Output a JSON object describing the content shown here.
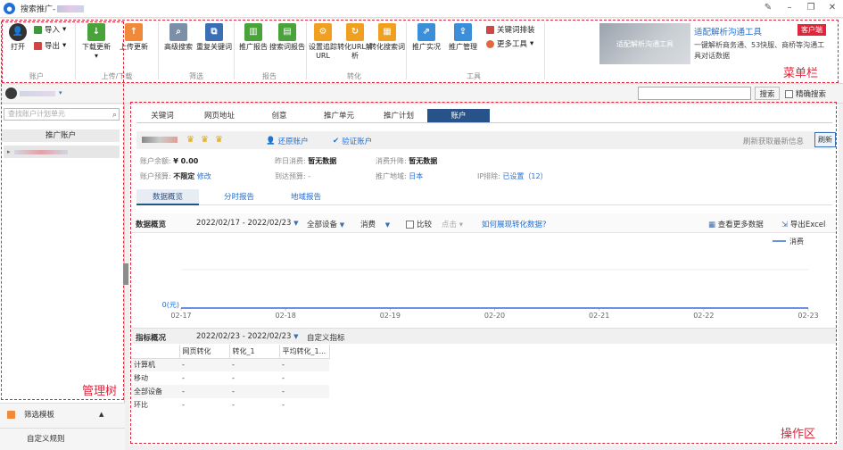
{
  "window": {
    "title": "搜索推广-"
  },
  "ribbon": {
    "groups": {
      "account": "账户",
      "updown": "上传/下载",
      "filter": "筛选",
      "report": "报告",
      "convert": "转化",
      "tools": "工具"
    },
    "open": "打开",
    "import": "导入",
    "export": "导出",
    "download": "下载更新",
    "upload": "上传更新",
    "advanced_search": "高级搜索",
    "repeat_kw": "重复关键词",
    "promo_report": "推广报告",
    "search_term_report": "搜索词报告",
    "set_tracking": "设置追踪URL",
    "url_parse": "转化URL解析",
    "search_convert": "转化搜索词",
    "promo_live": "推广实况",
    "promo_manage": "推广管理",
    "kw_tool": "关键词排装",
    "more_tools": "更多工具",
    "promo": {
      "image_text": "适配解析沟通工具",
      "title": "适配解析沟通工具",
      "badge": "客户端",
      "desc": "一键解析商务通、53快服、商桥等沟通工具对话数据"
    },
    "menu_label": "菜单栏"
  },
  "userbar": {
    "search_btn": "搜索",
    "exact": "精确搜索"
  },
  "tree": {
    "search_placeholder": "查找账户计划单元",
    "header": "推广账户",
    "label": "管理树",
    "filter_template": "筛选模板",
    "custom_rule": "自定义规则"
  },
  "work": {
    "label": "操作区",
    "tabs": [
      "关键词",
      "网页地址",
      "创意",
      "推广单元",
      "推广计划",
      "账户"
    ],
    "restore": "还原账户",
    "verify": "验证账户",
    "refresh": "刷新获取最新信息",
    "refresh_btn": "刷新",
    "info": {
      "balance_l": "账户余额:",
      "balance_v": "¥ 0.00",
      "yday_l": "昨日消费:",
      "yday_v": "暂无数据",
      "trend_l": "消费升降:",
      "trend_v": "暂无数据",
      "budget_l": "账户预算:",
      "budget_v": "不限定",
      "budget_edit": "修改",
      "reach_l": "到达预算:",
      "reach_v": "-",
      "region_l": "推广地域:",
      "region_v": "日本",
      "ip_l": "IP排除:",
      "ip_v": "已设置（12）"
    },
    "subtabs": [
      "数据概览",
      "分时报告",
      "地域报告"
    ],
    "overview": {
      "title": "数据概览",
      "range": "2022/02/17 - 2022/02/23",
      "device": "全部设备",
      "metric": "消费",
      "compare": "比较",
      "click": "点击",
      "how": "如何展现转化数据?",
      "more": "查看更多数据",
      "export": "导出Excel"
    },
    "indicator": {
      "title": "指标概况",
      "range": "2022/02/23 - 2022/02/23",
      "custom": "自定义指标",
      "headers": [
        "",
        "网页转化",
        "转化_1",
        "平均转化_1..."
      ],
      "rows": [
        [
          "计算机",
          "-",
          "-",
          "-"
        ],
        [
          "移动",
          "-",
          "-",
          "-"
        ],
        [
          "全部设备",
          "-",
          "-",
          "-"
        ],
        [
          "环比",
          "-",
          "-",
          "-"
        ]
      ]
    }
  },
  "chart_data": {
    "type": "line",
    "x": [
      "02-17",
      "02-18",
      "02-19",
      "02-20",
      "02-21",
      "02-22",
      "02-23"
    ],
    "series": [
      {
        "name": "消费",
        "values": [
          0,
          0,
          0,
          0,
          0,
          0,
          0
        ]
      }
    ],
    "ylabel": "0(元)",
    "color": "#3a6fd8"
  }
}
